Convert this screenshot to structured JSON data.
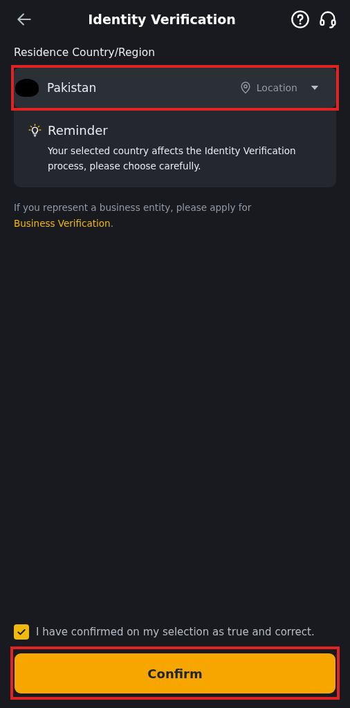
{
  "header": {
    "title": "Identity Verification"
  },
  "country_field": {
    "label": "Residence Country/Region",
    "value": "Pakistan",
    "redacted": true,
    "location_label": "Location",
    "highlighted": true
  },
  "reminder": {
    "title": "Reminder",
    "text": "Your selected country affects the Identity Verification process, please choose carefully."
  },
  "business_note": {
    "text": "If you represent a business entity, please apply for",
    "link": "Business Verification",
    "after": "."
  },
  "consent": {
    "text": "I have confirmed on my selection as true and correct.",
    "checked": true
  },
  "confirm_button": {
    "label": "Confirm",
    "highlighted": true
  }
}
